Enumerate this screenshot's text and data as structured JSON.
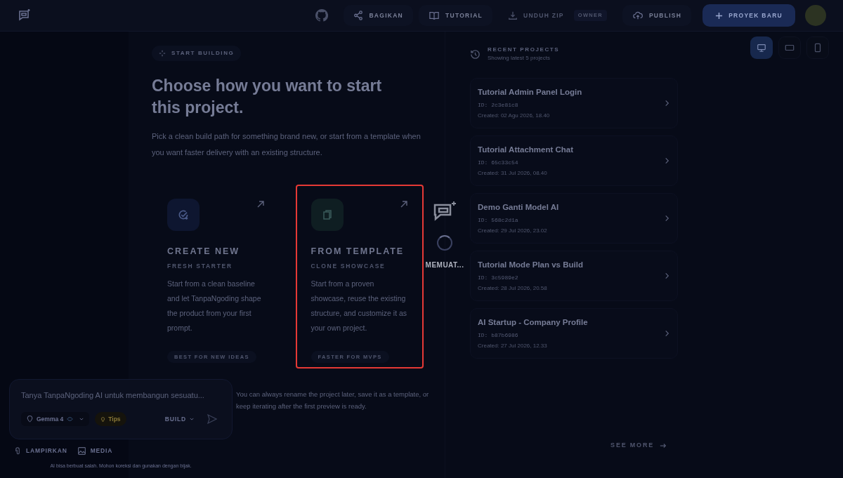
{
  "header": {
    "actions": [
      {
        "kind": "share",
        "label": "BAGIKAN",
        "disabled": false
      },
      {
        "kind": "tutorial",
        "label": "TUTORIAL",
        "disabled": false
      },
      {
        "kind": "download",
        "label": "UNDUH ZIP",
        "badge": "OWNER",
        "disabled": true
      },
      {
        "kind": "publish",
        "label": "PUBLISH",
        "disabled": false
      }
    ],
    "new_project": "PROYEK BARU"
  },
  "start": {
    "badge": "START BUILDING",
    "title": "Choose how you want to start this project.",
    "description": "Pick a clean build path for something brand new, or start from a template when you want faster delivery with an existing structure.",
    "options": [
      {
        "kind": "new",
        "title": "CREATE NEW",
        "subtitle": "FRESH STARTER",
        "description": "Start from a clean baseline and let TanpaNgoding shape the product from your first prompt.",
        "tag": "BEST FOR NEW IDEAS",
        "selected": false
      },
      {
        "kind": "template",
        "title": "FROM TEMPLATE",
        "subtitle": "CLONE SHOWCASE",
        "description": "Start from a proven showcase, reuse the existing structure, and customize it as your own project.",
        "tag": "FASTER FOR MVPS",
        "selected": true
      }
    ],
    "footnote": "You can always rename the project later, save it as a template, or keep iterating after the first preview is ready."
  },
  "recent": {
    "title": "RECENT PROJECTS",
    "subtitle": "Showing latest 5 projects",
    "projects": [
      {
        "name": "Tutorial Admin Panel Login",
        "id": "ID: 2c3e81c8",
        "created": "Created: 02 Agu 2026, 18.40"
      },
      {
        "name": "Tutorial Attachment Chat",
        "id": "ID: 65c33c54",
        "created": "Created: 31 Jul 2026, 08.40"
      },
      {
        "name": "Demo Ganti Model AI",
        "id": "ID: 568c2d1a",
        "created": "Created: 29 Jul 2026, 23.02"
      },
      {
        "name": "Tutorial Mode Plan vs Build",
        "id": "ID: 3c5989e2",
        "created": "Created: 28 Jul 2026, 20.58"
      },
      {
        "name": "AI Startup - Company Profile",
        "id": "ID: b87b6986",
        "created": "Created: 27 Jul 2026, 12.33"
      }
    ],
    "see_more": "SEE MORE"
  },
  "devices": [
    {
      "kind": "desktop",
      "selected": true
    },
    {
      "kind": "tablet",
      "selected": false
    },
    {
      "kind": "phone",
      "selected": false
    }
  ],
  "chat": {
    "placeholder": "Tanya TanpaNgoding AI untuk membangun sesuatu...",
    "model": "Gemma 4",
    "tips": "Tips",
    "mode": "BUILD",
    "attachments": [
      {
        "kind": "attach",
        "label": "LAMPIRKAN"
      },
      {
        "kind": "media",
        "label": "MEDIA"
      }
    ],
    "disclaimer": "AI bisa berbuat salah. Mohon koreksi dan gunakan dengan bijak."
  },
  "loading": {
    "label": "MEMUAT..."
  }
}
